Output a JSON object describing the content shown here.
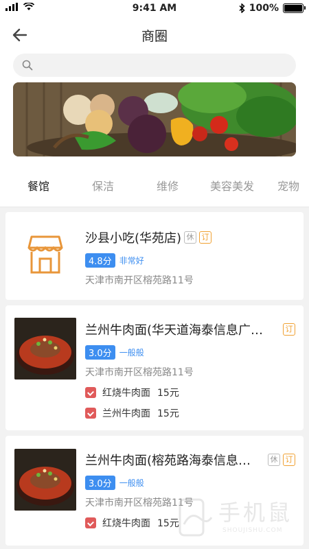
{
  "status_bar": {
    "time": "9:41 AM",
    "battery": "100%"
  },
  "nav": {
    "title": "商圈"
  },
  "search": {
    "placeholder": ""
  },
  "tabs": [
    {
      "label": "餐馆",
      "active": true
    },
    {
      "label": "保洁",
      "active": false
    },
    {
      "label": "维修",
      "active": false
    },
    {
      "label": "美容美发",
      "active": false
    },
    {
      "label": "宠物",
      "active": false
    }
  ],
  "shops": [
    {
      "name": "沙县小吃(华苑店)",
      "tags": [
        "休",
        "订"
      ],
      "score": "4.8分",
      "score_word": "非常好",
      "address": "天津市南开区榕苑路11号",
      "dishes": []
    },
    {
      "name": "兰州牛肉面(华天道海泰信息广…",
      "tags": [
        "订"
      ],
      "score": "3.0分",
      "score_word": "一般般",
      "address": "天津市南开区榕苑路11号",
      "dishes": [
        {
          "name": "红烧牛肉面",
          "price": "15元"
        },
        {
          "name": "兰州牛肉面",
          "price": "15元"
        }
      ]
    },
    {
      "name": "兰州牛肉面(榕苑路海泰信息…",
      "tags": [
        "休",
        "订"
      ],
      "score": "3.0分",
      "score_word": "一般般",
      "address": "天津市南开区榕苑路11号",
      "dishes": [
        {
          "name": "红烧牛肉面",
          "price": "15元"
        }
      ]
    }
  ],
  "watermark": {
    "text": "手机鼠",
    "sub": "SHOUJISHU.COM"
  },
  "colors": {
    "accent": "#3d8ef0",
    "book_tag": "#f0a030",
    "store_icon": "#e8963a",
    "dish_icon": "#e05a5a"
  }
}
